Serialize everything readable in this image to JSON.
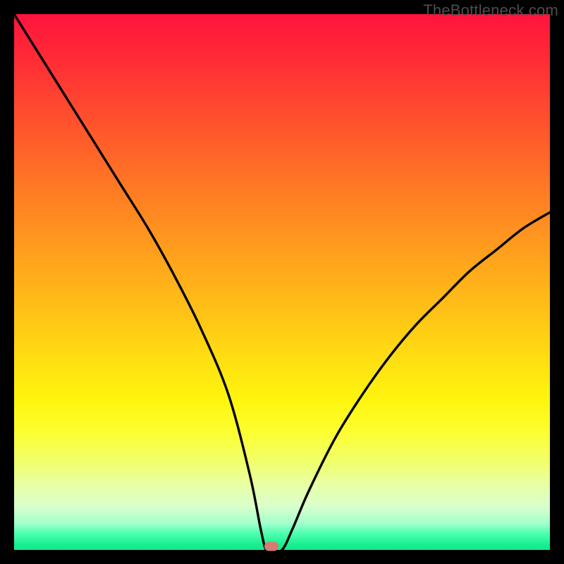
{
  "chart_data": {
    "type": "line",
    "x": [
      0,
      5,
      10,
      15,
      20,
      25,
      30,
      35,
      40,
      44,
      46,
      47,
      48,
      50,
      52,
      55,
      60,
      65,
      70,
      75,
      80,
      85,
      90,
      95,
      100
    ],
    "values": [
      100,
      92,
      84,
      76,
      68,
      60,
      51,
      41,
      29,
      14,
      4,
      0,
      0,
      0,
      4,
      11,
      21,
      29,
      36,
      42,
      47,
      52,
      56,
      60,
      63
    ],
    "title": "",
    "xlabel": "",
    "ylabel": "",
    "xlim": [
      0,
      100
    ],
    "ylim": [
      0,
      100
    ],
    "annotation_point": {
      "x": 48,
      "y": 0
    },
    "watermark": "TheBottleneck.com"
  },
  "colors": {
    "curve": "#000000",
    "marker": "#d97a73",
    "frame": "#000000"
  }
}
